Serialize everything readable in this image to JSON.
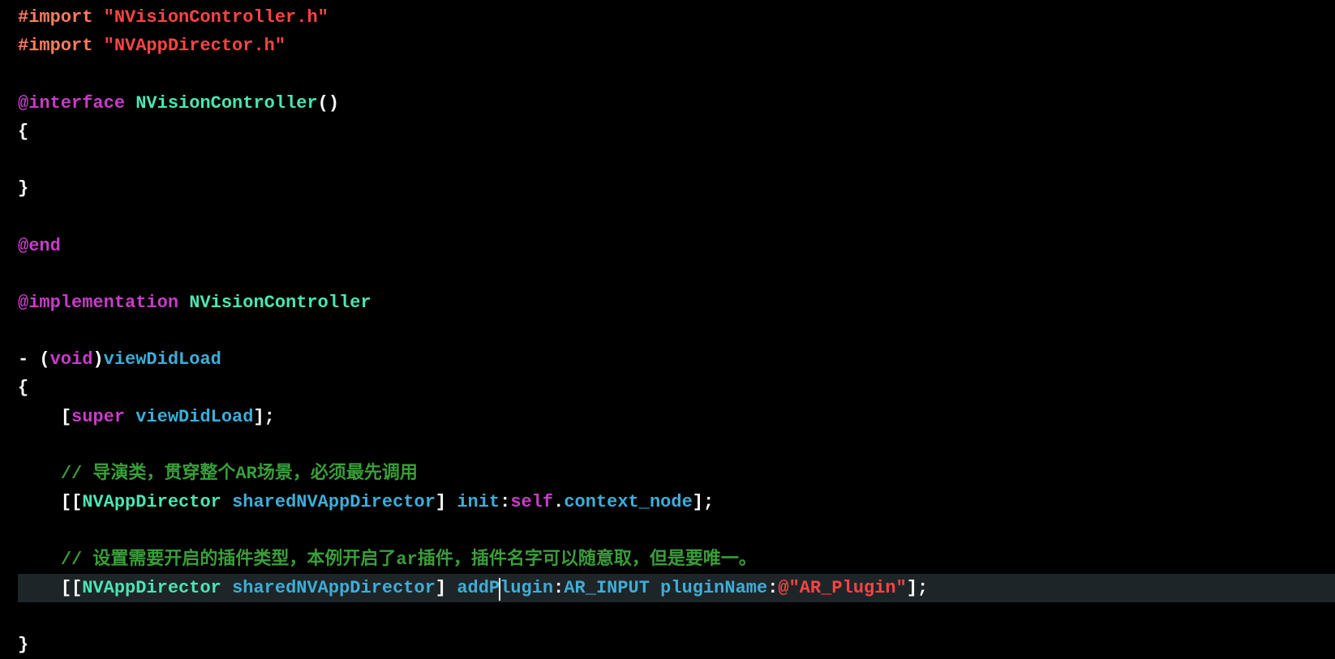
{
  "code": {
    "l1_import": "#import",
    "l1_str": "\"NVisionController.h\"",
    "l2_import": "#import",
    "l2_str": "\"NVAppDirector.h\"",
    "l4_at": "@interface",
    "l4_type": " NVisionController",
    "l4_paren": "()",
    "l5_brace": "{",
    "l7_brace": "}",
    "l9_end": "@end",
    "l11_impl": "@implementation",
    "l11_type": " NVisionController",
    "l13_dash": "- ",
    "l13_po": "(",
    "l13_void": "void",
    "l13_pc": ")",
    "l13_method": "viewDidLoad",
    "l14_brace": "{",
    "l15_indent": "    ",
    "l15_bo": "[",
    "l15_super": "super",
    "l15_sp": " ",
    "l15_method": "viewDidLoad",
    "l15_bc": "];",
    "l17_indent": "    ",
    "l17_comment": "// 导演类，贯穿整个AR场景，必须最先调用",
    "l18_indent": "    ",
    "l18_bo": "[[",
    "l18_cls": "NVAppDirector",
    "l18_sp1": " ",
    "l18_m1": "sharedNVAppDirector",
    "l18_bc1": "] ",
    "l18_m2": "init",
    "l18_colon": ":",
    "l18_self": "self",
    "l18_dot": ".",
    "l18_prop": "context_node",
    "l18_bc2": "];",
    "l20_indent": "    ",
    "l20_comment": "// 设置需要开启的插件类型，本例开启了ar插件，插件名字可以随意取，但是要唯一。",
    "l21_indent": "    ",
    "l21_bo": "[[",
    "l21_cls": "NVAppDirector",
    "l21_sp1": " ",
    "l21_m1": "sharedNVAppDirector",
    "l21_bc1": "] ",
    "l21_m2a": "addP",
    "l21_m2b": "lugin",
    "l21_colon1": ":",
    "l21_const": "AR_INPUT",
    "l21_sp2": " ",
    "l21_m3": "pluginName",
    "l21_colon2": ":",
    "l21_at": "@",
    "l21_str": "\"AR_Plugin\"",
    "l21_bc2": "];",
    "l23_brace": "}"
  }
}
